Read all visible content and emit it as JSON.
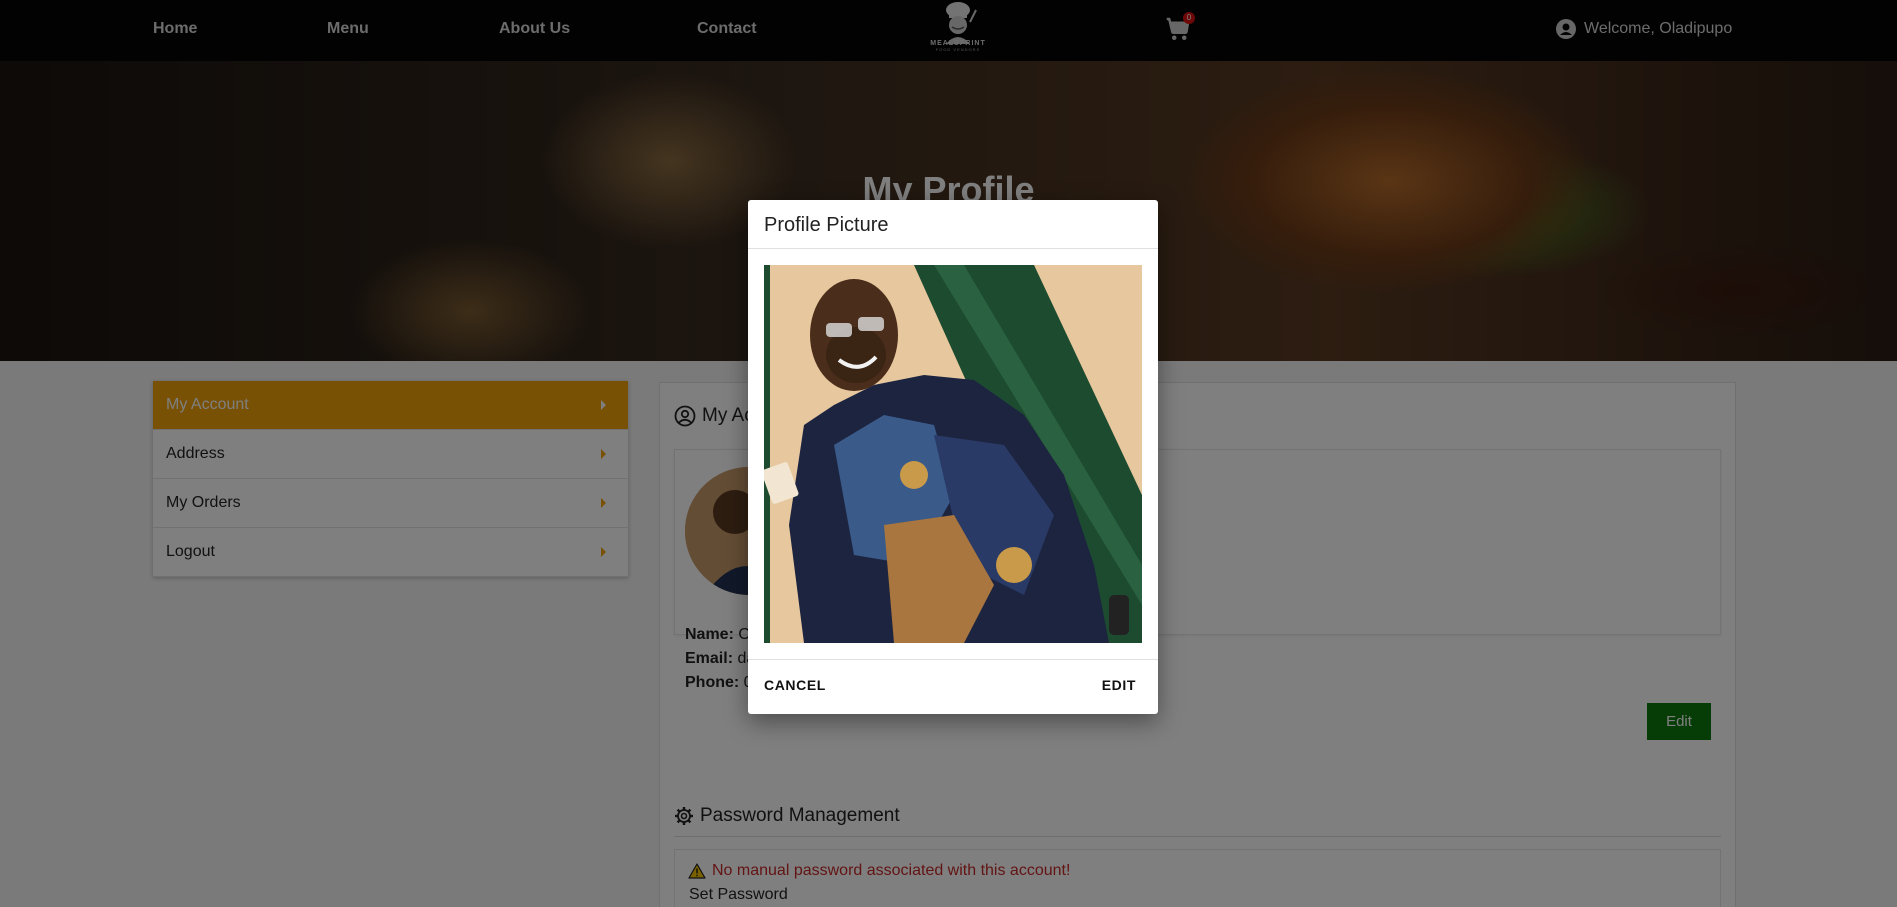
{
  "nav": {
    "links": [
      "Home",
      "Menu",
      "About Us",
      "Contact"
    ],
    "logo_text": "MEALSPRINT",
    "logo_subtext": "FOOD VENDORS",
    "cart_count": "0",
    "welcome": "Welcome, Oladipupo"
  },
  "hero": {
    "title": "My Profile"
  },
  "sidebar": {
    "items": [
      {
        "label": "My Account",
        "active": true
      },
      {
        "label": "Address"
      },
      {
        "label": "My Orders"
      },
      {
        "label": "Logout"
      }
    ]
  },
  "account": {
    "title": "My Account",
    "name_label": "Name:",
    "name_value": "O",
    "email_label": "Email:",
    "email_value": "da",
    "phone_label": "Phone:",
    "phone_value": "0",
    "edit_label": "Edit"
  },
  "password": {
    "title": "Password Management",
    "warning": "No manual password associated with this account!",
    "set_label": "Set Password"
  },
  "modal": {
    "title": "Profile Picture",
    "cancel_label": "CANCEL",
    "edit_label": "EDIT"
  },
  "colors": {
    "accent": "#f0a20a",
    "edit_button": "#0d7a0d",
    "warning": "#c62828",
    "navbar": "#050505"
  }
}
